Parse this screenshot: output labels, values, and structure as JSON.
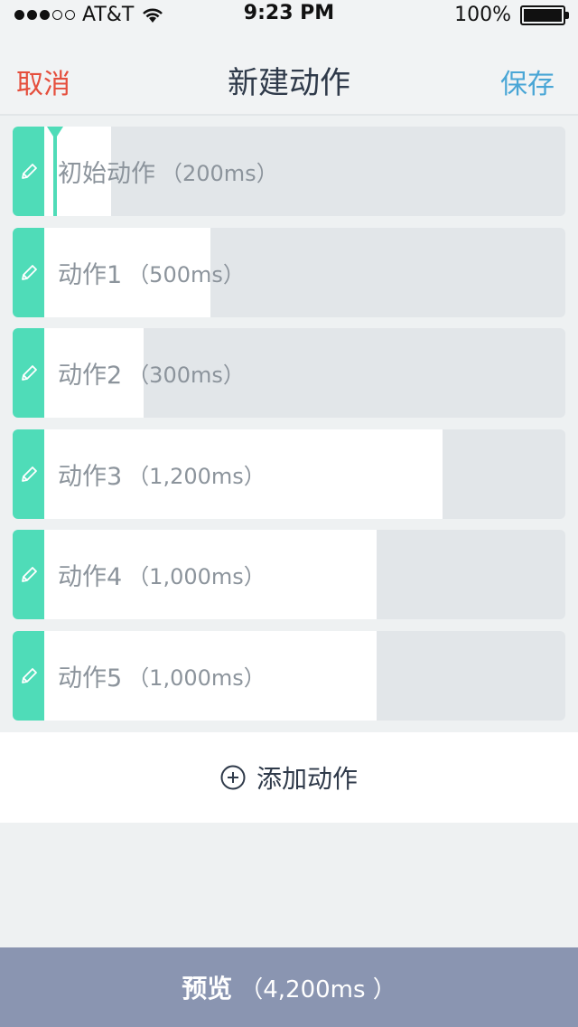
{
  "status_bar": {
    "carrier": "AT&T",
    "time": "9:23 PM",
    "battery": "100%",
    "signal_bars": 3,
    "signal_total": 5
  },
  "nav": {
    "cancel_label": "取消",
    "title": "新建动作",
    "save_label": "保存"
  },
  "colors": {
    "accent": "#4fdcb8",
    "cancel": "#e54f3d",
    "save": "#49a6d6",
    "preview_bg": "#8a95b1"
  },
  "actions": [
    {
      "label": "初始动作",
      "duration": "（200ms）",
      "duration_ms": 200,
      "has_playhead": true
    },
    {
      "label": "动作1",
      "duration": "（500ms）",
      "duration_ms": 500
    },
    {
      "label": "动作2",
      "duration": "（300ms）",
      "duration_ms": 300
    },
    {
      "label": "动作3",
      "duration": "（1,200ms）",
      "duration_ms": 1200
    },
    {
      "label": "动作4",
      "duration": "（1,000ms）",
      "duration_ms": 1000
    },
    {
      "label": "动作5",
      "duration": "（1,000ms）",
      "duration_ms": 1000
    }
  ],
  "add_action": {
    "icon": "plus-circle-icon",
    "label": "添加动作"
  },
  "preview": {
    "title": "预览",
    "duration": "（4,200ms ）"
  }
}
